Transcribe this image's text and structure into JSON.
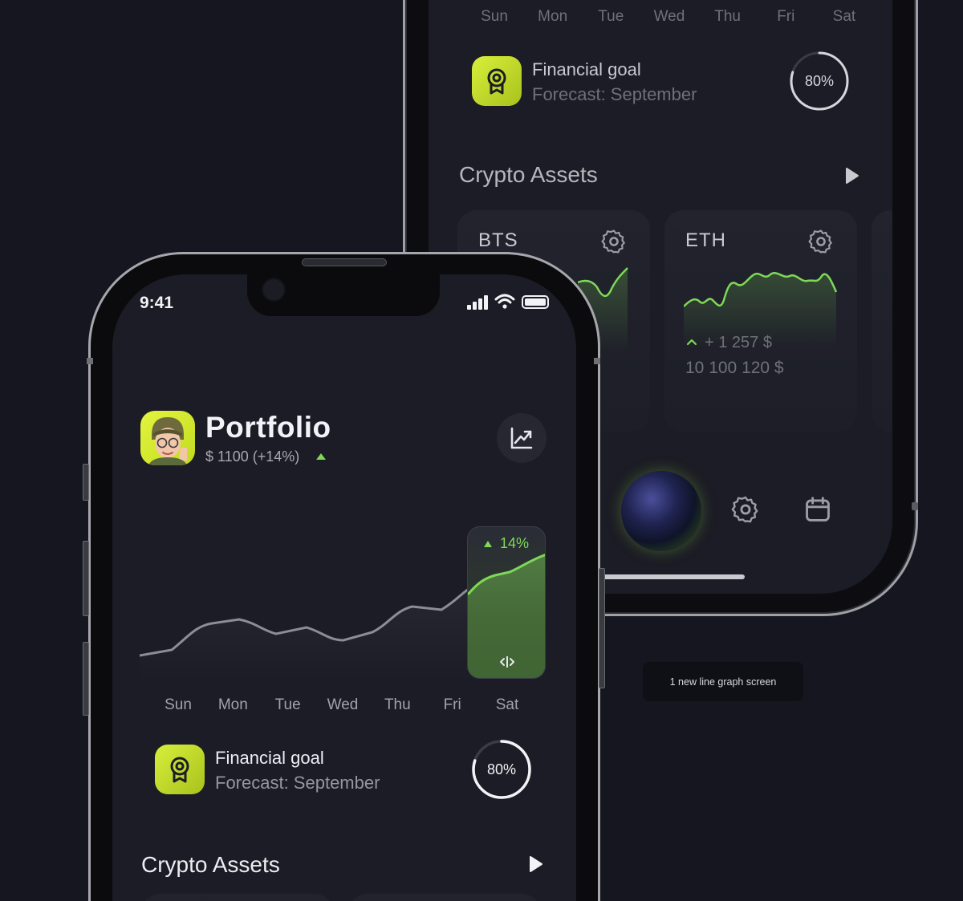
{
  "front": {
    "status_time": "9:41",
    "title": "Portfolio",
    "balance": "$ 1100 (+14%)",
    "chart_highlight": "14%",
    "days": [
      "Sun",
      "Mon",
      "Tue",
      "Wed",
      "Thu",
      "Fri",
      "Sat"
    ],
    "goal_title": "Financial goal",
    "goal_forecast": "Forecast: September",
    "goal_percent": "80%",
    "goal_progress": 0.8,
    "crypto_title": "Crypto Assets"
  },
  "back": {
    "days": [
      "Sun",
      "Mon",
      "Tue",
      "Wed",
      "Thu",
      "Fri",
      "Sat"
    ],
    "goal_title": "Financial goal",
    "goal_forecast": "Forecast: September",
    "goal_percent": "80%",
    "goal_progress": 0.8,
    "crypto_title": "Crypto Assets",
    "cards": [
      {
        "name": "BTS"
      },
      {
        "name": "ETH",
        "change": "+ 1 257 $",
        "value": "10 100 120 $"
      }
    ]
  },
  "note": "1 new line graph screen",
  "colors": {
    "background": "#15161f",
    "screen": "#1b1c25",
    "accent_green": "#7ed957",
    "goal_yellow": "#d7ef3a"
  }
}
